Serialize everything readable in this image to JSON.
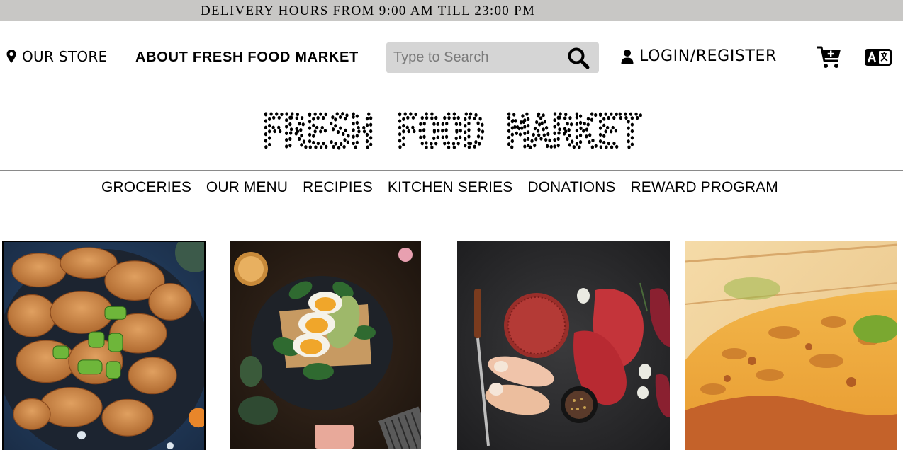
{
  "banner": {
    "text": "DELIVERY HOURS FROM 9:00 AM TILL 23:00 PM"
  },
  "topnav": {
    "store_label": "OUR STORE",
    "about_label": "ABOUT FRESH FOOD MARKET",
    "login_label": "LOGIN/REGISTER",
    "icons": [
      "map-pin-icon",
      "search-icon",
      "user-icon",
      "cart-plus-icon",
      "translate-icon"
    ]
  },
  "search": {
    "placeholder": "Type to Search",
    "value": ""
  },
  "logo": {
    "text": "FRESH FOOD MARKET"
  },
  "categories": [
    {
      "label": "GROCERIES"
    },
    {
      "label": "OUR MENU"
    },
    {
      "label": "RECIPIES"
    },
    {
      "label": "KITCHEN SERIES"
    },
    {
      "label": "DONATIONS"
    },
    {
      "label": "REWARD PROGRAM"
    }
  ],
  "tiles": [
    {
      "subject": "spiced chips with green onion"
    },
    {
      "subject": "toast with egg and avocado"
    },
    {
      "subject": "raw meats and chicken"
    },
    {
      "subject": "baked lasagna"
    }
  ],
  "colors": {
    "banner_bg": "#c8c7c5",
    "search_bg": "#d5d5d5",
    "text": "#000000"
  }
}
